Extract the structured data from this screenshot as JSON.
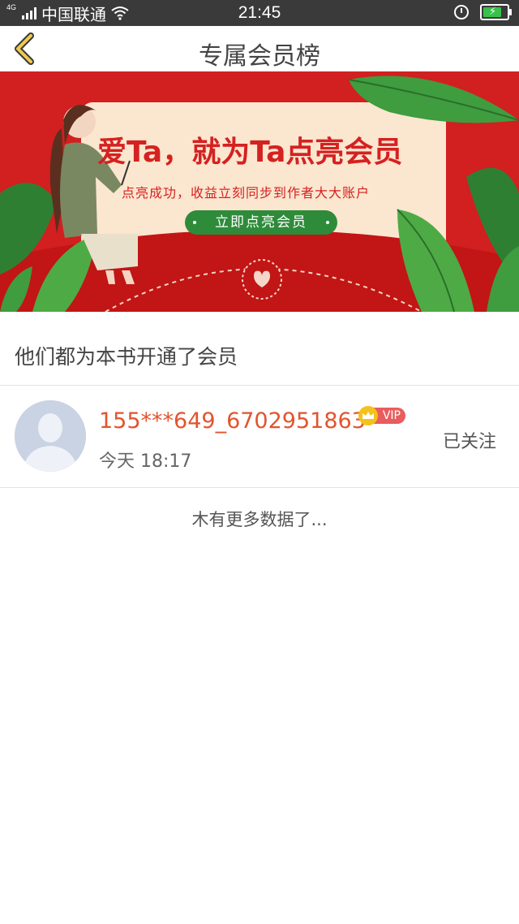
{
  "status_bar": {
    "network_type": "4G",
    "carrier": "中国联通",
    "time": "21:45"
  },
  "header": {
    "title": "专属会员榜",
    "back_icon": "chevron-left-icon",
    "accent_color": "#f2c94c"
  },
  "banner": {
    "headline": "爱Ta，就为Ta点亮会员",
    "subtitle": "点亮成功，收益立刻同步到作者大大账户",
    "button_label": "立即点亮会员",
    "background_color": "#d21f1f",
    "button_color": "#2e8b3a"
  },
  "section": {
    "title": "他们都为本书开通了会员"
  },
  "members": [
    {
      "name": "155***649_6702951863",
      "badge": "VIP",
      "time": "今天 18:17",
      "follow_status": "已关注"
    }
  ],
  "footer": {
    "no_more_text": "木有更多数据了..."
  }
}
